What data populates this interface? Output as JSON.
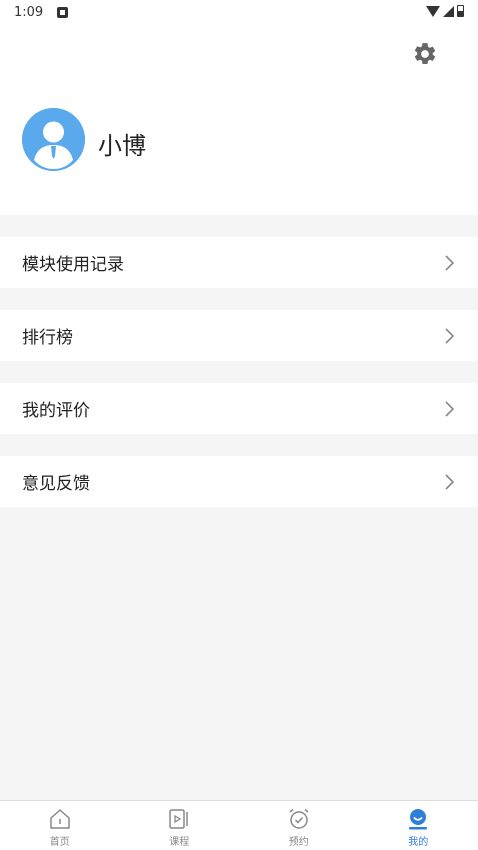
{
  "status_bar": {
    "time": "1:09"
  },
  "profile": {
    "name": "小博"
  },
  "menu": {
    "items": [
      {
        "label": "模块使用记录"
      },
      {
        "label": "排行榜"
      },
      {
        "label": "我的评价"
      },
      {
        "label": "意见反馈"
      }
    ]
  },
  "bottom_nav": {
    "tabs": [
      {
        "label": "首页",
        "icon": "home-icon"
      },
      {
        "label": "课程",
        "icon": "course-icon"
      },
      {
        "label": "预约",
        "icon": "alarm-icon"
      },
      {
        "label": "我的",
        "icon": "profile-icon",
        "active": true
      }
    ]
  },
  "colors": {
    "accent": "#2f7fd8",
    "avatar": "#5aa9ec",
    "background": "#f5f5f5"
  }
}
